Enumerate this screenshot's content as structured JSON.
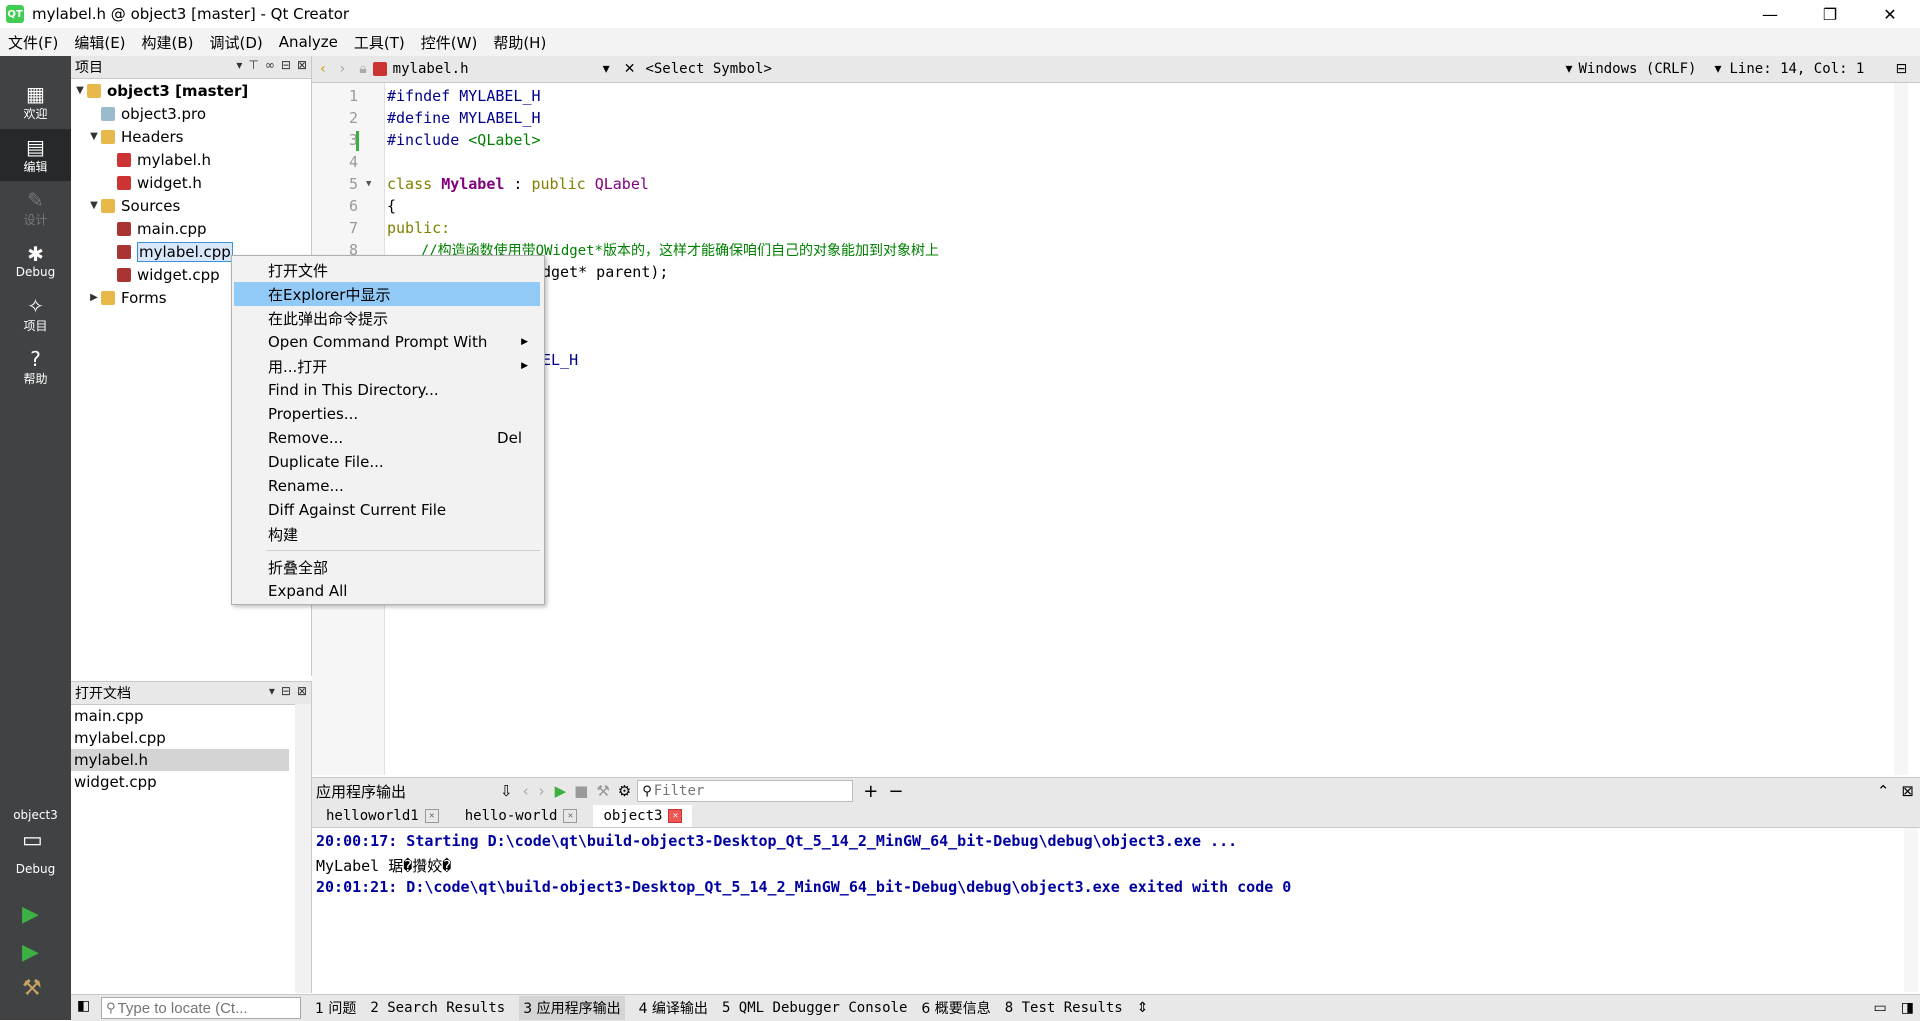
{
  "window": {
    "title": "mylabel.h @ object3 [master] - Qt Creator",
    "logo_text": "QT",
    "minimize": "—",
    "maximize": "❐",
    "close": "✕"
  },
  "menubar": [
    "文件(F)",
    "编辑(E)",
    "构建(B)",
    "调试(D)",
    "Analyze",
    "工具(T)",
    "控件(W)",
    "帮助(H)"
  ],
  "modes": [
    {
      "label": "欢迎",
      "icon": "grid-icon"
    },
    {
      "label": "编辑",
      "icon": "edit-icon"
    },
    {
      "label": "设计",
      "icon": "design-icon"
    },
    {
      "label": "Debug",
      "icon": "bug-icon"
    },
    {
      "label": "项目",
      "icon": "wrench-icon"
    },
    {
      "label": "帮助",
      "icon": "help-icon"
    }
  ],
  "kit": {
    "project": "object3",
    "mode": "Debug"
  },
  "project_panel": {
    "title": "项目",
    "tree": {
      "root": "object3 [master]",
      "pro": "object3.pro",
      "headers": "Headers",
      "header_files": [
        "mylabel.h",
        "widget.h"
      ],
      "sources": "Sources",
      "source_files": [
        "main.cpp",
        "mylabel.cpp",
        "widget.cpp"
      ],
      "forms": "Forms"
    }
  },
  "open_docs": {
    "title": "打开文档",
    "items": [
      "main.cpp",
      "mylabel.cpp",
      "mylabel.h",
      "widget.cpp"
    ]
  },
  "editor_toolbar": {
    "file": "mylabel.h",
    "symbol": "<Select Symbol>",
    "line_ending": "Windows (CRLF)",
    "position": "Line: 14, Col: 1"
  },
  "editor": {
    "line_numbers": [
      "1",
      "2",
      "3",
      "4",
      "5",
      "6",
      "7",
      "8"
    ],
    "lines": {
      "l1": "#ifndef MYLABEL_H",
      "l2": "#define MYLABEL_H",
      "l3a": "#include ",
      "l3b": "<QLabel>",
      "l5a": "class ",
      "l5b": "Mylabel",
      "l5c": " : ",
      "l5d": "public ",
      "l5e": "QLabel",
      "l6": "{",
      "l7": "public:",
      "l8": "    //构造函数使用带QWidget*版本的，这样才能确保咱们自己的对象能加到对象树上",
      "l9": "dget* parent);",
      "l13": "EL_H"
    }
  },
  "context_menu": {
    "items": [
      "打开文件",
      "在Explorer中显示",
      "在此弹出命令提示",
      "Open Command Prompt With",
      "用...打开",
      "Find in This Directory...",
      "Properties...",
      "Remove...",
      "Duplicate File...",
      "Rename...",
      "Diff Against Current File",
      "构建",
      "折叠全部",
      "Expand All"
    ],
    "remove_shortcut": "Del"
  },
  "output": {
    "title": "应用程序输出",
    "filter_placeholder": "Filter",
    "tabs": [
      "helloworld1",
      "hello-world",
      "object3"
    ],
    "lines": [
      "20:00:17: Starting D:\\code\\qt\\build-object3-Desktop_Qt_5_14_2_MinGW_64_bit-Debug\\debug\\object3.exe ...",
      "MyLabel 琚�攢姣�",
      "20:01:21: D:\\code\\qt\\build-object3-Desktop_Qt_5_14_2_MinGW_64_bit-Debug\\debug\\object3.exe exited with code 0"
    ]
  },
  "statusbar": {
    "locate_placeholder": "Type to locate (Ct...",
    "tabs": [
      "1 问题",
      "2 Search Results",
      "3 应用程序输出",
      "4 编译输出",
      "5 QML Debugger Console",
      "6 概要信息",
      "8 Test Results"
    ]
  }
}
